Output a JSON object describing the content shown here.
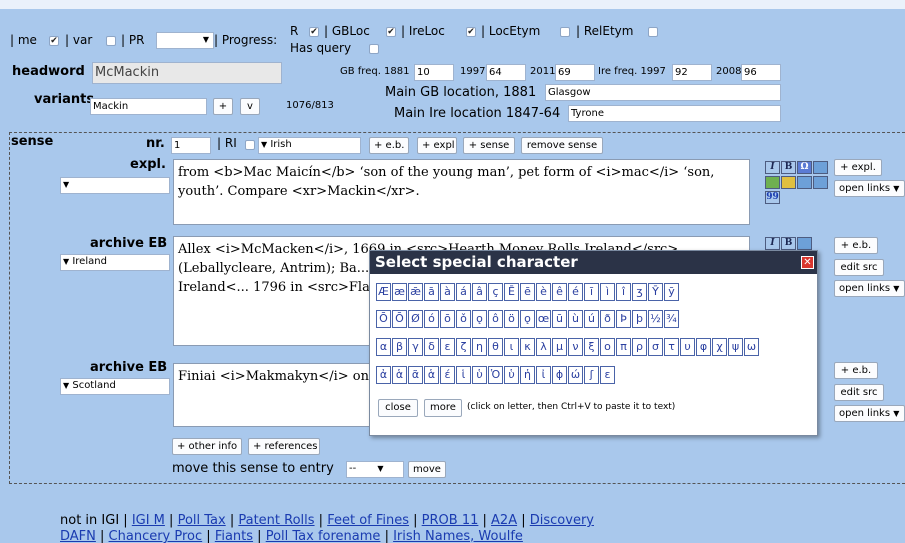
{
  "toolbar": {
    "me": "| me",
    "var": "| var",
    "pr": "| PR",
    "progress": "| Progress:",
    "r": "R",
    "gbloc": "| GBLoc",
    "ireloc": "| IreLoc",
    "locetym": "| LocEtym",
    "reletym": "| RelEtym",
    "has_query": "Has query",
    "checked": "✔"
  },
  "headword": {
    "label": "headword",
    "value": "McMackin"
  },
  "freq": {
    "gb_label": "GB freq. 1881",
    "gb_1881": "10",
    "y1997": "1997",
    "gb_1997": "64",
    "y2011": "2011",
    "gb_2011": "69",
    "ire_label": "Ire freq. 1997",
    "ire_1997": "92",
    "y2008": "2008",
    "ire_2008": "96"
  },
  "variants": {
    "label": "variants",
    "value": "Mackin",
    "plus": "+",
    "v": "v",
    "count": "1076/813"
  },
  "locations": {
    "gb_label": "Main GB location, 1881",
    "gb_value": "Glasgow",
    "ire_label": "Main Ire location 1847-64",
    "ire_value": "Tyrone"
  },
  "sense": {
    "label": "sense",
    "nr_label": "nr.",
    "nr_value": "1",
    "ri_label": "| RI",
    "lang_value": "Irish",
    "eb_btn": "+ e.b.",
    "expl_btn": "+ expl",
    "sense_btn": "+ sense",
    "remove_btn": "remove sense"
  },
  "expl": {
    "label": "expl.",
    "text": "from <b>Mac Maicín</b> ‘son of the young man’, pet form of <i>mac</i> ‘son, youth’. Compare <xr>Mackin</xr>."
  },
  "archive1": {
    "label": "archive EB",
    "select": "Ireland",
    "text": "Allex <i>McMacken</i>, 1669 in <src>Hearth Money Rolls Ireland</src> (Leballycleare, Antrim); Ba... Ireland</src> (Ardstraw, T... <src>Flaxgrowers Ireland<... 1796 in <src>Flaxgrowers I..."
  },
  "archive2": {
    "label": "archive EB",
    "select": "Scotland",
    "text": "Finiai <i>Makmakyn</i> on... (Rhinns); Michell <i>Macm..."
  },
  "right_buttons": {
    "plus_expl": "+ expl.",
    "open_links": "open links",
    "plus_eb": "+ e.b.",
    "edit_src": "edit src"
  },
  "bottom_buttons": {
    "other_info": "+ other info",
    "references": "+ references",
    "move_label": "move this sense to entry",
    "move_select": "--",
    "move_btn": "move"
  },
  "popup": {
    "title": "Select special character",
    "close": "close",
    "more": "more",
    "hint": "(click on letter, then Ctrl+V to paste it to text)",
    "row1": [
      "Æ",
      "æ",
      "ǣ",
      "ā",
      "à",
      "á",
      "â",
      "ç",
      "Ē",
      "ē",
      "è",
      "ê",
      "é",
      "ī",
      "ì",
      "î",
      "ʒ",
      "Ȳ",
      "ȳ"
    ],
    "row2": [
      "Ō",
      "Ō",
      "Ø",
      "ó",
      "ō",
      "ǒ",
      "ǫ",
      "ô",
      "ö",
      "ǫ",
      "œ",
      "ū",
      "ù",
      "ú",
      "ð",
      "Þ",
      "þ",
      "½",
      "¾"
    ],
    "row3": [
      "α",
      "β",
      "γ",
      "δ",
      "ε",
      "ζ",
      "η",
      "θ",
      "ι",
      "κ",
      "λ",
      "μ",
      "ν",
      "ξ",
      "ο",
      "π",
      "ρ",
      "σ",
      "τ",
      "υ",
      "φ",
      "χ",
      "ψ",
      "ω"
    ],
    "row4": [
      "ἀ",
      "ἁ",
      "ᾶ",
      "ἁ",
      "έ",
      "ἱ",
      "ὑ",
      "Ὁ",
      "ὑ",
      "ἡ",
      "ἰ",
      "ϕ",
      "ώ",
      "ʃ",
      "ɛ"
    ]
  },
  "footer": {
    "line1_prefix": "not in IGI |",
    "links1": [
      "IGI M",
      "Poll Tax",
      "Patent Rolls",
      "Feet of Fines",
      "PROB 11",
      "A2A",
      "Discovery"
    ],
    "links2": [
      "DAFN",
      "Chancery Proc",
      "Fiants",
      "Poll Tax forename",
      "Irish Names, Woulfe"
    ]
  }
}
